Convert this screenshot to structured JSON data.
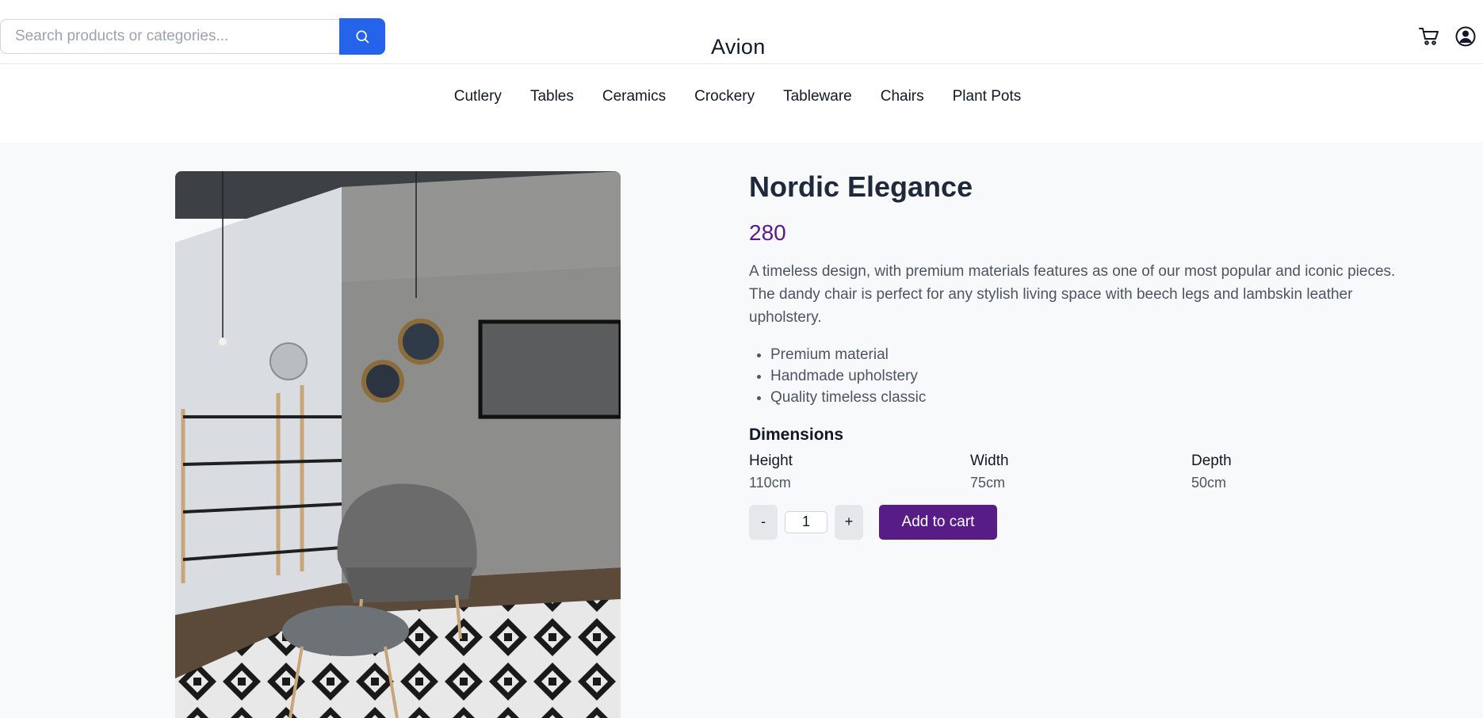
{
  "search": {
    "placeholder": "Search products or categories..."
  },
  "header": {
    "logo": "Avion",
    "cart_icon": "cart-icon",
    "user_icon": "user-icon"
  },
  "nav": {
    "items": [
      "Cutlery",
      "Tables",
      "Ceramics",
      "Crockery",
      "Tableware",
      "Chairs",
      "Plant Pots"
    ]
  },
  "product": {
    "title": "Nordic Elegance",
    "price": "280",
    "description": "A timeless design, with premium materials features as one of our most popular and iconic pieces. The dandy chair is perfect for any stylish living space with beech legs and lambskin leather upholstery.",
    "features": [
      "Premium material",
      "Handmade upholstery",
      "Quality timeless classic"
    ],
    "dimensions": {
      "heading": "Dimensions",
      "items": [
        {
          "label": "Height",
          "value": "110cm"
        },
        {
          "label": "Width",
          "value": "75cm"
        },
        {
          "label": "Depth",
          "value": "50cm"
        }
      ]
    },
    "quantity": "1",
    "decrement_label": "-",
    "increment_label": "+",
    "add_to_cart_label": "Add to cart"
  },
  "colors": {
    "search_button": "#2563eb",
    "price": "#5b1a8c",
    "add_to_cart": "#581c87",
    "page_background": "#f8f9fb"
  }
}
